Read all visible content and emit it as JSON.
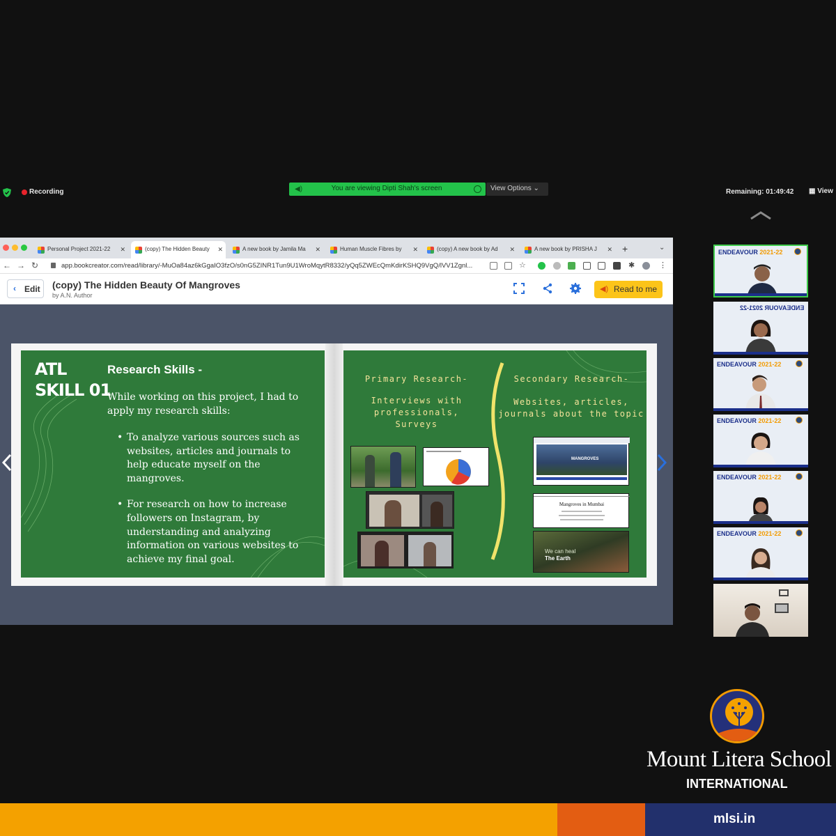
{
  "zoom": {
    "recording_label": "Recording",
    "share_banner": "You are viewing Dipti Shah's screen",
    "view_options": "View Options",
    "remaining": "Remaining: 01:49:42",
    "view_label": "View"
  },
  "browser": {
    "tabs": [
      {
        "label": "Personal Project 2021-22"
      },
      {
        "label": "(copy) The Hidden Beauty"
      },
      {
        "label": "A new book by Jamila Ma"
      },
      {
        "label": "Human Muscle Fibres by"
      },
      {
        "label": "(copy) A new book by Ad"
      },
      {
        "label": "A new book by PRISHA J"
      }
    ],
    "url": "app.bookcreator.com/read/library/-MuOa84az6kGgaIO3fzO/s0nG5ZINR1Tun9U1WroMqytR8332/yQq5ZWEcQmKdirKSHQ9VgQ/lVV1Zgnl..."
  },
  "book": {
    "edit_label": "Edit",
    "title": "(copy) The Hidden Beauty Of Mangroves",
    "author": "by A.N. Author",
    "read_label": "Read to me"
  },
  "left_page": {
    "atl_line1": "ATL",
    "atl_line2": "SKILL 01",
    "title": "Research Skills -",
    "intro": "While working on this project, I had to apply my research skills:",
    "bullets": [
      "To analyze various sources such as websites, articles and journals to help educate myself on the mangroves.",
      "For research on how to increase followers on Instagram, by understanding and analyzing information on various websites to achieve my final goal."
    ]
  },
  "right_page": {
    "primary_heading": "Primary Research-",
    "primary_sub": [
      "Interviews with",
      "professionals,",
      "Surveys"
    ],
    "secondary_heading": "Secondary Research-",
    "secondary_sub": [
      "Websites, articles,",
      "journals about the topic"
    ],
    "site_banner": "MANGROVES",
    "doc_title": "Mangroves in Mumbai",
    "earth_text_1": "We can heal",
    "earth_text_2": "The Earth"
  },
  "participants": {
    "banner_main": "ENDEAVOUR",
    "banner_year": "2021-22",
    "banner_mirrored": "ENDEAVOUR 2021-22"
  },
  "branding": {
    "school_name": "Mount Litera School",
    "school_sub": "INTERNATIONAL",
    "website": "mlsi.in"
  },
  "colors": {
    "share_green": "#23c24a",
    "page_green": "#2f7a3a",
    "brand_yellow": "#f4a100",
    "brand_orange": "#e35d12",
    "brand_navy": "#22306c",
    "read_button": "#fcc419"
  }
}
